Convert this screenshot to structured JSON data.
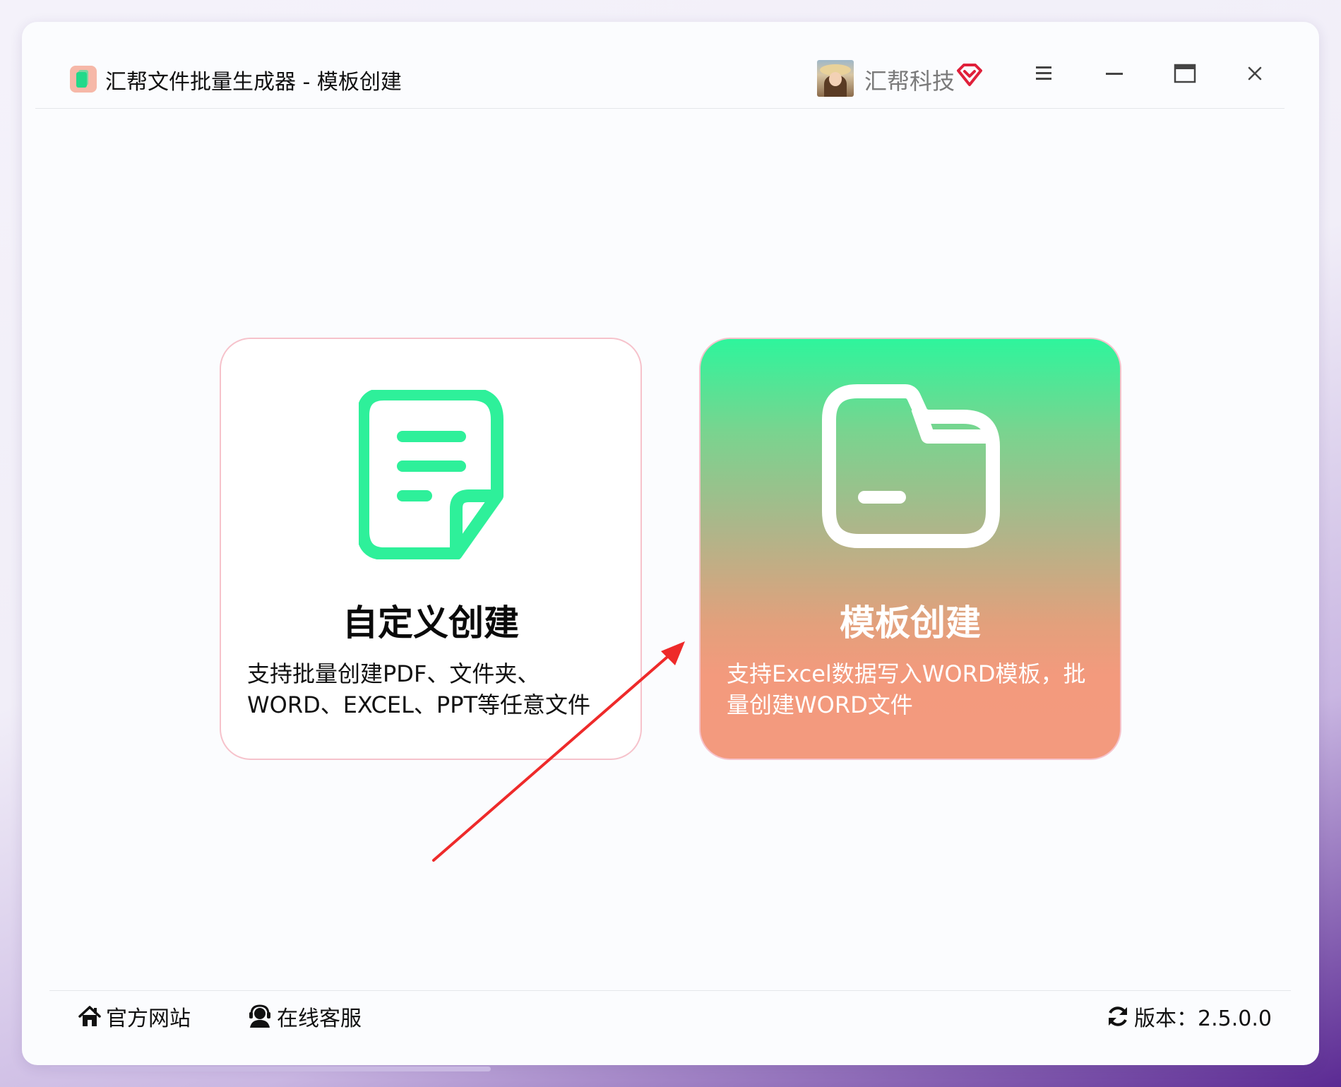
{
  "window": {
    "title": "汇帮文件批量生成器 - 模板创建",
    "username": "汇帮科技"
  },
  "icons": {
    "app": "app-logo-icon",
    "avatar": "user-avatar",
    "vip": "vip-diamond-icon",
    "menu": "menu-icon",
    "minimize": "minimize-icon",
    "maximize": "maximize-icon",
    "close": "close-icon",
    "custom_card": "document-icon",
    "template_card": "folder-icon",
    "website": "home-icon",
    "service": "headset-icon",
    "version": "refresh-icon"
  },
  "colors": {
    "accent_green": "#2ef59c",
    "accent_coral": "#f39a7d",
    "vip_red": "#e0203a",
    "arrow_red": "#ee2a2a"
  },
  "cards": {
    "custom": {
      "title": "自定义创建",
      "desc_line1": "支持批量创建PDF、文件夹、",
      "desc_line2": "WORD、EXCEL、PPT等任意文件"
    },
    "template": {
      "title": "模板创建",
      "desc_line1": "支持Excel数据写入WORD模板，批",
      "desc_line2": "量创建WORD文件",
      "selected": true
    }
  },
  "footer": {
    "website": "官方网站",
    "service": "在线客服",
    "version": "版本：2.5.0.0"
  }
}
